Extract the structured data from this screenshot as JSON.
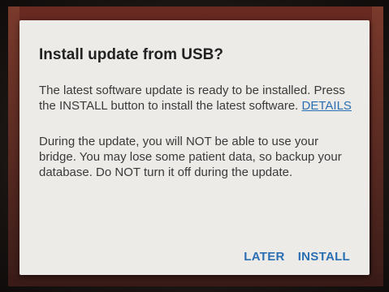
{
  "dialog": {
    "title": "Install update from USB?",
    "paragraph1_text": "The latest software update is ready to be installed. Press the INSTALL button to install the latest software.",
    "details_link": "DETAILS",
    "paragraph2_text": "During the update, you will NOT be able to use your bridge. You may lose some patient data, so backup your database. Do NOT turn it off during the update.",
    "buttons": {
      "later": "LATER",
      "install": "INSTALL"
    }
  },
  "colors": {
    "dialog_background": "#ecebe8",
    "accent": "#2a6fb3",
    "title_text": "#222222",
    "body_text": "#3a3a3a"
  }
}
